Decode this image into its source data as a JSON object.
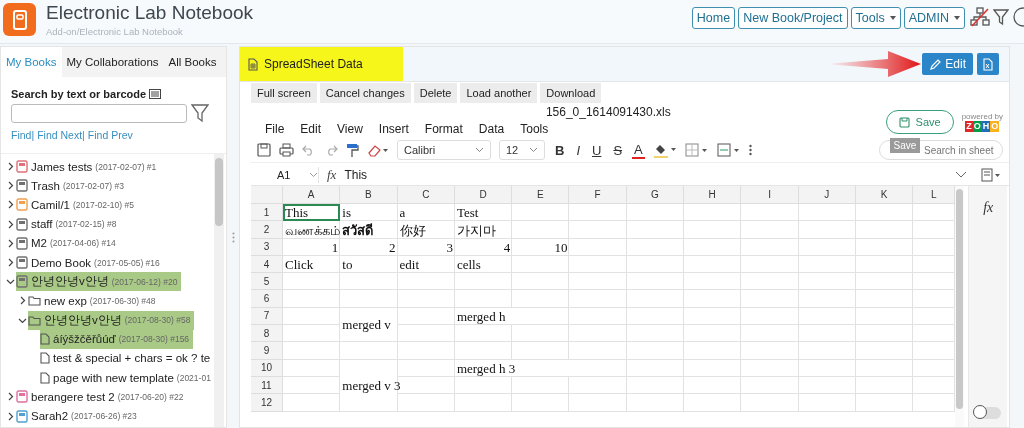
{
  "app": {
    "title": "Electronic Lab Notebook",
    "subtitle": "Add-on/Electronic Lab Notebook"
  },
  "nav": [
    {
      "label": "Home",
      "kind": "button"
    },
    {
      "label": "New Book/Project",
      "kind": "button"
    },
    {
      "label": "Tools",
      "kind": "dropdown"
    },
    {
      "label": "ADMIN",
      "kind": "dropdown"
    }
  ],
  "sidebar": {
    "tabs": [
      {
        "label": "My Books",
        "selected": true
      },
      {
        "label": "My Collaborations",
        "selected": false
      },
      {
        "label": "All Books",
        "selected": false
      }
    ],
    "search": {
      "label": "Search by text or barcode"
    },
    "links": [
      "Find|",
      "Find Next|",
      "Find Prev"
    ],
    "tree": [
      {
        "kind": "book",
        "name": "James tests",
        "meta": "(2017-02-07) #1",
        "color": "#e0707a",
        "expanded": false,
        "selected": false
      },
      {
        "kind": "book",
        "name": "Trash",
        "meta": "(2017-02-07) #3",
        "color": "#707070",
        "expanded": false,
        "selected": false
      },
      {
        "kind": "book",
        "name": "Camil/1",
        "meta": "(2017-02-10) #5",
        "color": "#f0a050",
        "expanded": false,
        "selected": false
      },
      {
        "kind": "book",
        "name": "staff",
        "meta": "(2017-02-15) #8",
        "color": "#707070",
        "expanded": false,
        "selected": false
      },
      {
        "kind": "book",
        "name": "M2",
        "meta": "(2017-04-06) #14",
        "color": "#707070",
        "expanded": false,
        "selected": false
      },
      {
        "kind": "book",
        "name": "Demo Book",
        "meta": "(2017-05-05) #16",
        "color": "#707070",
        "expanded": false,
        "selected": false
      },
      {
        "kind": "book",
        "name": "안녕안녕v안녕",
        "meta": "(2017-06-12) #20",
        "color": "#707070",
        "expanded": true,
        "selected": true,
        "children": [
          {
            "kind": "folder",
            "name": "new exp",
            "meta": "(2017-06-30) #48",
            "expanded": false,
            "selected": false
          },
          {
            "kind": "folder",
            "name": "안녕안녕v안녕",
            "meta": "(2017-08-30) #58",
            "expanded": true,
            "selected": true,
            "children": [
              {
                "kind": "page",
                "name": "áíýšžčěřůúď",
                "meta": "(2017-08-30) #156",
                "selected": true
              },
              {
                "kind": "page",
                "name": "test & special + chars = ok ? te",
                "selected": false
              },
              {
                "kind": "page",
                "name": "page with new template",
                "meta": "(2021-01",
                "selected": false
              }
            ]
          }
        ]
      },
      {
        "kind": "book",
        "name": "berangere test 2",
        "meta": "(2017-06-20) #22",
        "color": "#e070a0",
        "expanded": false,
        "selected": false
      },
      {
        "kind": "book",
        "name": "Sarah2",
        "meta": "(2017-06-26) #23",
        "color": "#50a0d0",
        "expanded": false,
        "selected": false
      }
    ]
  },
  "panel": {
    "title": "SpreadSheet Data",
    "highlighted": true,
    "edit_button": "Edit",
    "actions": [
      "Full screen",
      "Cancel changes",
      "Delete",
      "Load another",
      "Download"
    ],
    "sheet": {
      "filename": "156_0_1614091430.xls",
      "menu": [
        "File",
        "Edit",
        "View",
        "Insert",
        "Format",
        "Data",
        "Tools"
      ],
      "save_button": "Save",
      "tooltip": "Save",
      "powered_by": "powered by",
      "zoho_letters": [
        {
          "letter": "Z",
          "color": "#e42527"
        },
        {
          "letter": "O",
          "color": "#089949"
        },
        {
          "letter": "H",
          "color": "#226db4"
        },
        {
          "letter": "O",
          "color": "#f9b21d"
        }
      ],
      "font": "Calibri",
      "font_size": "12",
      "format_buttons": [
        "B",
        "I",
        "U",
        "S",
        "A"
      ],
      "search": {
        "placeholder": "Search in sheet"
      },
      "cell_ref": "A1",
      "fx": "fx",
      "formula": "This",
      "columns": [
        "A",
        "B",
        "C",
        "D",
        "E",
        "F",
        "G",
        "H",
        "I",
        "J",
        "K",
        "L"
      ],
      "grid_rows": [
        {
          "label": "1",
          "cells": [
            {
              "kind": "text",
              "text": "This",
              "selected": true
            },
            {
              "kind": "text",
              "text": "is",
              "selected": false
            },
            {
              "kind": "text",
              "text": "a",
              "selected": false
            },
            {
              "kind": "text",
              "text": "Test",
              "selected": false
            }
          ]
        },
        {
          "label": "2",
          "cells": [
            {
              "kind": "text",
              "text": "வணக்கம்",
              "selected": false
            },
            {
              "kind": "text",
              "text": "สวัสดี",
              "bold": true,
              "selected": false
            },
            {
              "kind": "text",
              "text": "你好",
              "selected": false
            },
            {
              "kind": "text",
              "text": "가지마",
              "selected": false
            }
          ]
        },
        {
          "label": "3",
          "cells": [
            {
              "kind": "number",
              "text": "1",
              "selected": false
            },
            {
              "kind": "number",
              "text": "2",
              "selected": false
            },
            {
              "kind": "number",
              "text": "3",
              "selected": false
            },
            {
              "kind": "number",
              "text": "4",
              "selected": false
            },
            {
              "kind": "number",
              "text": "10",
              "selected": false
            }
          ]
        },
        {
          "label": "4",
          "cells": [
            {
              "kind": "text",
              "text": "Click",
              "selected": false
            },
            {
              "kind": "text",
              "text": "to",
              "selected": false
            },
            {
              "kind": "text",
              "text": "edit",
              "selected": false
            },
            {
              "kind": "text",
              "text": "cells",
              "selected": false
            }
          ]
        },
        {
          "label": "5"
        },
        {
          "label": "6"
        },
        {
          "label": "7",
          "cells": [
            {
              "kind": "empty"
            },
            {
              "kind": "text",
              "text": "merged v",
              "selected": false
            },
            {
              "kind": "empty"
            },
            {
              "kind": "text",
              "text": "merged h",
              "selected": false
            },
            {
              "kind": "span_left"
            }
          ]
        },
        {
          "label": "8",
          "cells": [
            {
              "kind": "empty"
            },
            {
              "kind": "span_up"
            }
          ]
        },
        {
          "label": "9"
        },
        {
          "label": "10",
          "cells": [
            {
              "kind": "empty"
            },
            {
              "kind": "text",
              "text": "merged v 3",
              "selected": false
            },
            {
              "kind": "empty"
            },
            {
              "kind": "text",
              "text": "merged h 3",
              "selected": false
            },
            {
              "kind": "span_left"
            },
            {
              "kind": "span_left"
            }
          ]
        },
        {
          "label": "11",
          "cells": [
            {
              "kind": "empty"
            },
            {
              "kind": "span_up"
            }
          ]
        },
        {
          "label": "12",
          "cells": [
            {
              "kind": "empty"
            },
            {
              "kind": "span_up"
            }
          ]
        }
      ],
      "sidebar_fx": "fx",
      "toggle": {
        "on": false
      }
    }
  }
}
